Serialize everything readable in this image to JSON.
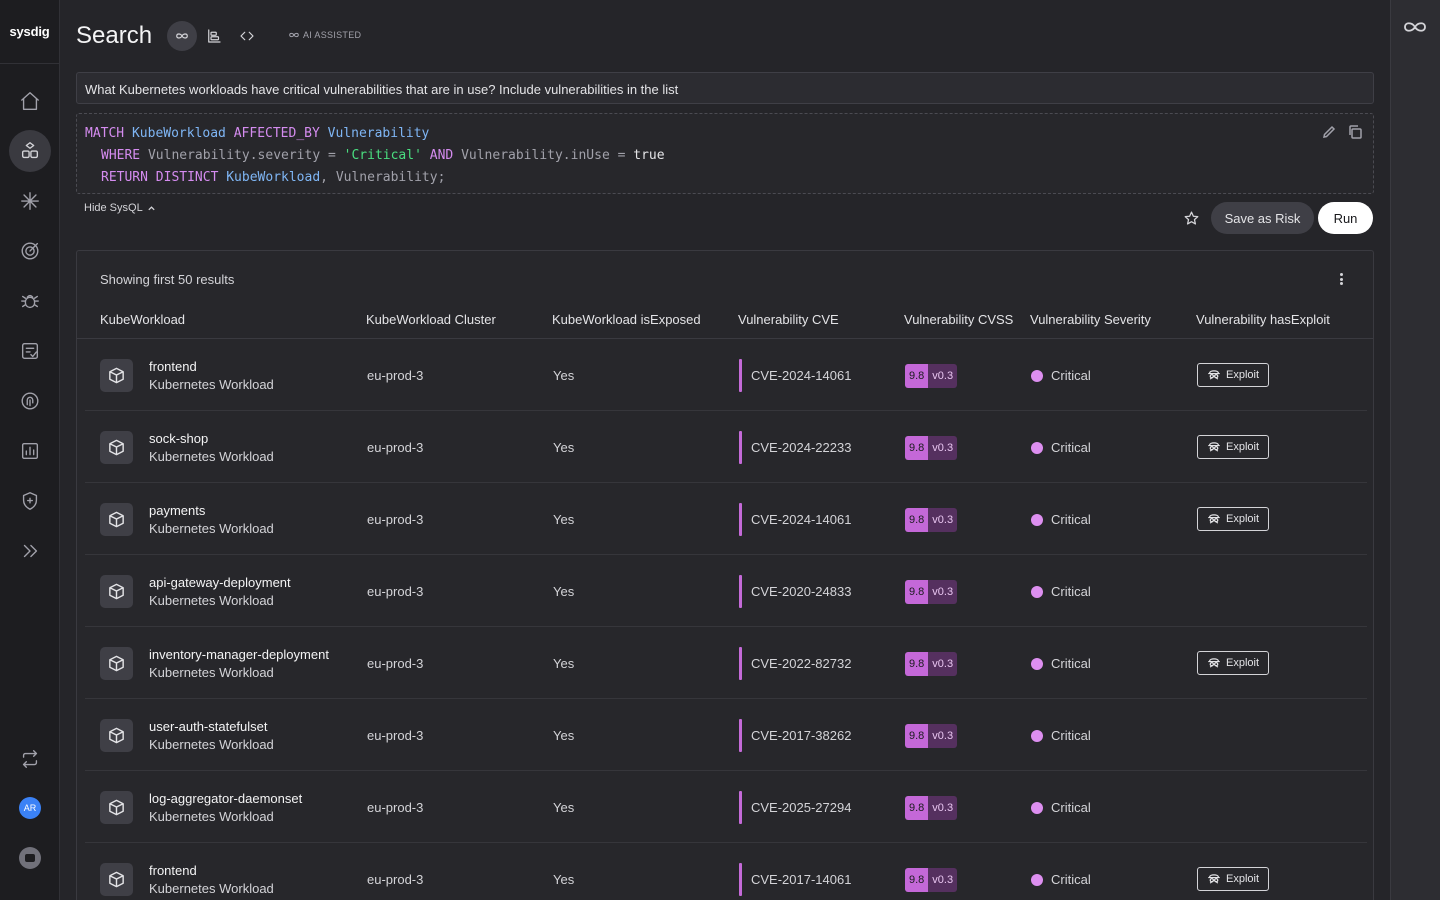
{
  "brand": "sysdig",
  "page_title": "Search",
  "ai_badge": "AI ASSISTED",
  "query": "What Kubernetes workloads have critical vulnerabilities that are in use? Include vulnerabilities in the list",
  "sysql": {
    "line1": [
      "MATCH",
      "KubeWorkload",
      "AFFECTED_BY",
      "Vulnerability"
    ],
    "line2": [
      "WHERE",
      "Vulnerability.severity",
      "=",
      "'Critical'",
      "AND",
      "Vulnerability.inUse",
      "=",
      "true"
    ],
    "line3": [
      "RETURN DISTINCT",
      "KubeWorkload",
      ",",
      "Vulnerability",
      ";"
    ]
  },
  "hide_sysql_label": "Hide SysQL",
  "save_as_risk_label": "Save as Risk",
  "run_label": "Run",
  "results": {
    "count_text": "Showing first 50 results",
    "columns": [
      "KubeWorkload",
      "KubeWorkload Cluster",
      "KubeWorkload isExposed",
      "Vulnerability CVE",
      "Vulnerability CVSS",
      "Vulnerability Severity",
      "Vulnerability hasExploit"
    ],
    "rows": [
      {
        "name": "frontend",
        "type": "Kubernetes Workload",
        "cluster": "eu-prod-3",
        "exposed": "Yes",
        "cve": "CVE-2024-14061",
        "cvss": "9.8",
        "cvss_version": "v0.3",
        "severity": "Critical",
        "exploit": "Exploit"
      },
      {
        "name": "sock-shop",
        "type": "Kubernetes Workload",
        "cluster": "eu-prod-3",
        "exposed": "Yes",
        "cve": "CVE-2024-22233",
        "cvss": "9.8",
        "cvss_version": "v0.3",
        "severity": "Critical",
        "exploit": "Exploit"
      },
      {
        "name": "payments",
        "type": "Kubernetes Workload",
        "cluster": "eu-prod-3",
        "exposed": "Yes",
        "cve": "CVE-2024-14061",
        "cvss": "9.8",
        "cvss_version": "v0.3",
        "severity": "Critical",
        "exploit": "Exploit"
      },
      {
        "name": "api-gateway-deployment",
        "type": "Kubernetes Workload",
        "cluster": "eu-prod-3",
        "exposed": "Yes",
        "cve": "CVE-2020-24833",
        "cvss": "9.8",
        "cvss_version": "v0.3",
        "severity": "Critical",
        "exploit": ""
      },
      {
        "name": "inventory-manager-deployment",
        "type": "Kubernetes Workload",
        "cluster": "eu-prod-3",
        "exposed": "Yes",
        "cve": "CVE-2022-82732",
        "cvss": "9.8",
        "cvss_version": "v0.3",
        "severity": "Critical",
        "exploit": "Exploit"
      },
      {
        "name": "user-auth-statefulset",
        "type": "Kubernetes Workload",
        "cluster": "eu-prod-3",
        "exposed": "Yes",
        "cve": "CVE-2017-38262",
        "cvss": "9.8",
        "cvss_version": "v0.3",
        "severity": "Critical",
        "exploit": ""
      },
      {
        "name": "log-aggregator-daemonset",
        "type": "Kubernetes Workload",
        "cluster": "eu-prod-3",
        "exposed": "Yes",
        "cve": "CVE-2025-27294",
        "cvss": "9.8",
        "cvss_version": "v0.3",
        "severity": "Critical",
        "exploit": ""
      },
      {
        "name": "frontend",
        "type": "Kubernetes Workload",
        "cluster": "eu-prod-3",
        "exposed": "Yes",
        "cve": "CVE-2017-14061",
        "cvss": "9.8",
        "cvss_version": "v0.3",
        "severity": "Critical",
        "exploit": "Exploit"
      }
    ]
  },
  "nav": {
    "items": [
      "home-icon",
      "inventory-icon",
      "threats-icon",
      "risk-target-icon",
      "vulnerabilities-bug-icon",
      "posture-checklist-icon",
      "identity-fingerprint-icon",
      "reports-chart-icon",
      "policies-shield-icon",
      "expand-chevrons-icon"
    ],
    "user_initials": "AR"
  },
  "colors": {
    "accent_pink": "#c468d8",
    "severity_critical": "#dd8ff0",
    "run_button": "#ffffff"
  }
}
